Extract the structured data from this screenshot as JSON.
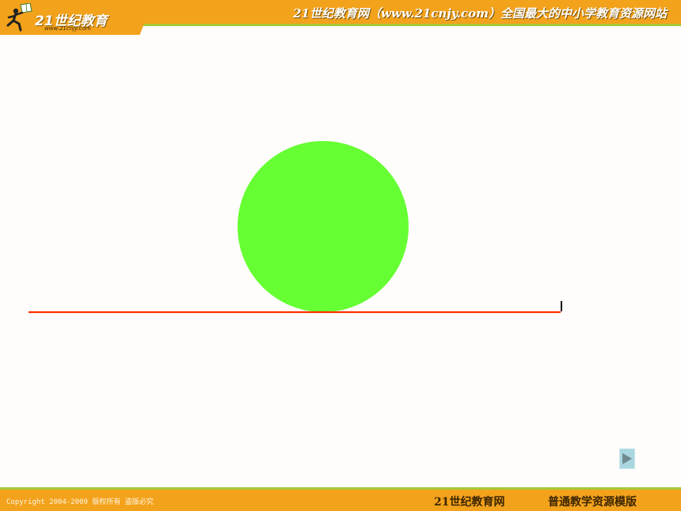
{
  "header": {
    "logo_text": "21世纪教育",
    "logo_url": "www.21cnjy.com",
    "tagline": "21世纪教育网（www.21cnjy.com）全国最大的中小学教育资源网站"
  },
  "slide": {
    "circle_color": "#66ff33",
    "line_color": "#ff3300",
    "marker_color": "#000000"
  },
  "navigation": {
    "next_icon": "play-triangle-icon"
  },
  "footer": {
    "copyright": "Copyright 2004-2009 版权所有 盗版必究",
    "site_name": "21世纪教育网",
    "template_name": "普通教学资源模版"
  },
  "colors": {
    "header_orange": "#f3a21c",
    "accent_green": "#a7c93a",
    "background": "#fffdfb"
  }
}
